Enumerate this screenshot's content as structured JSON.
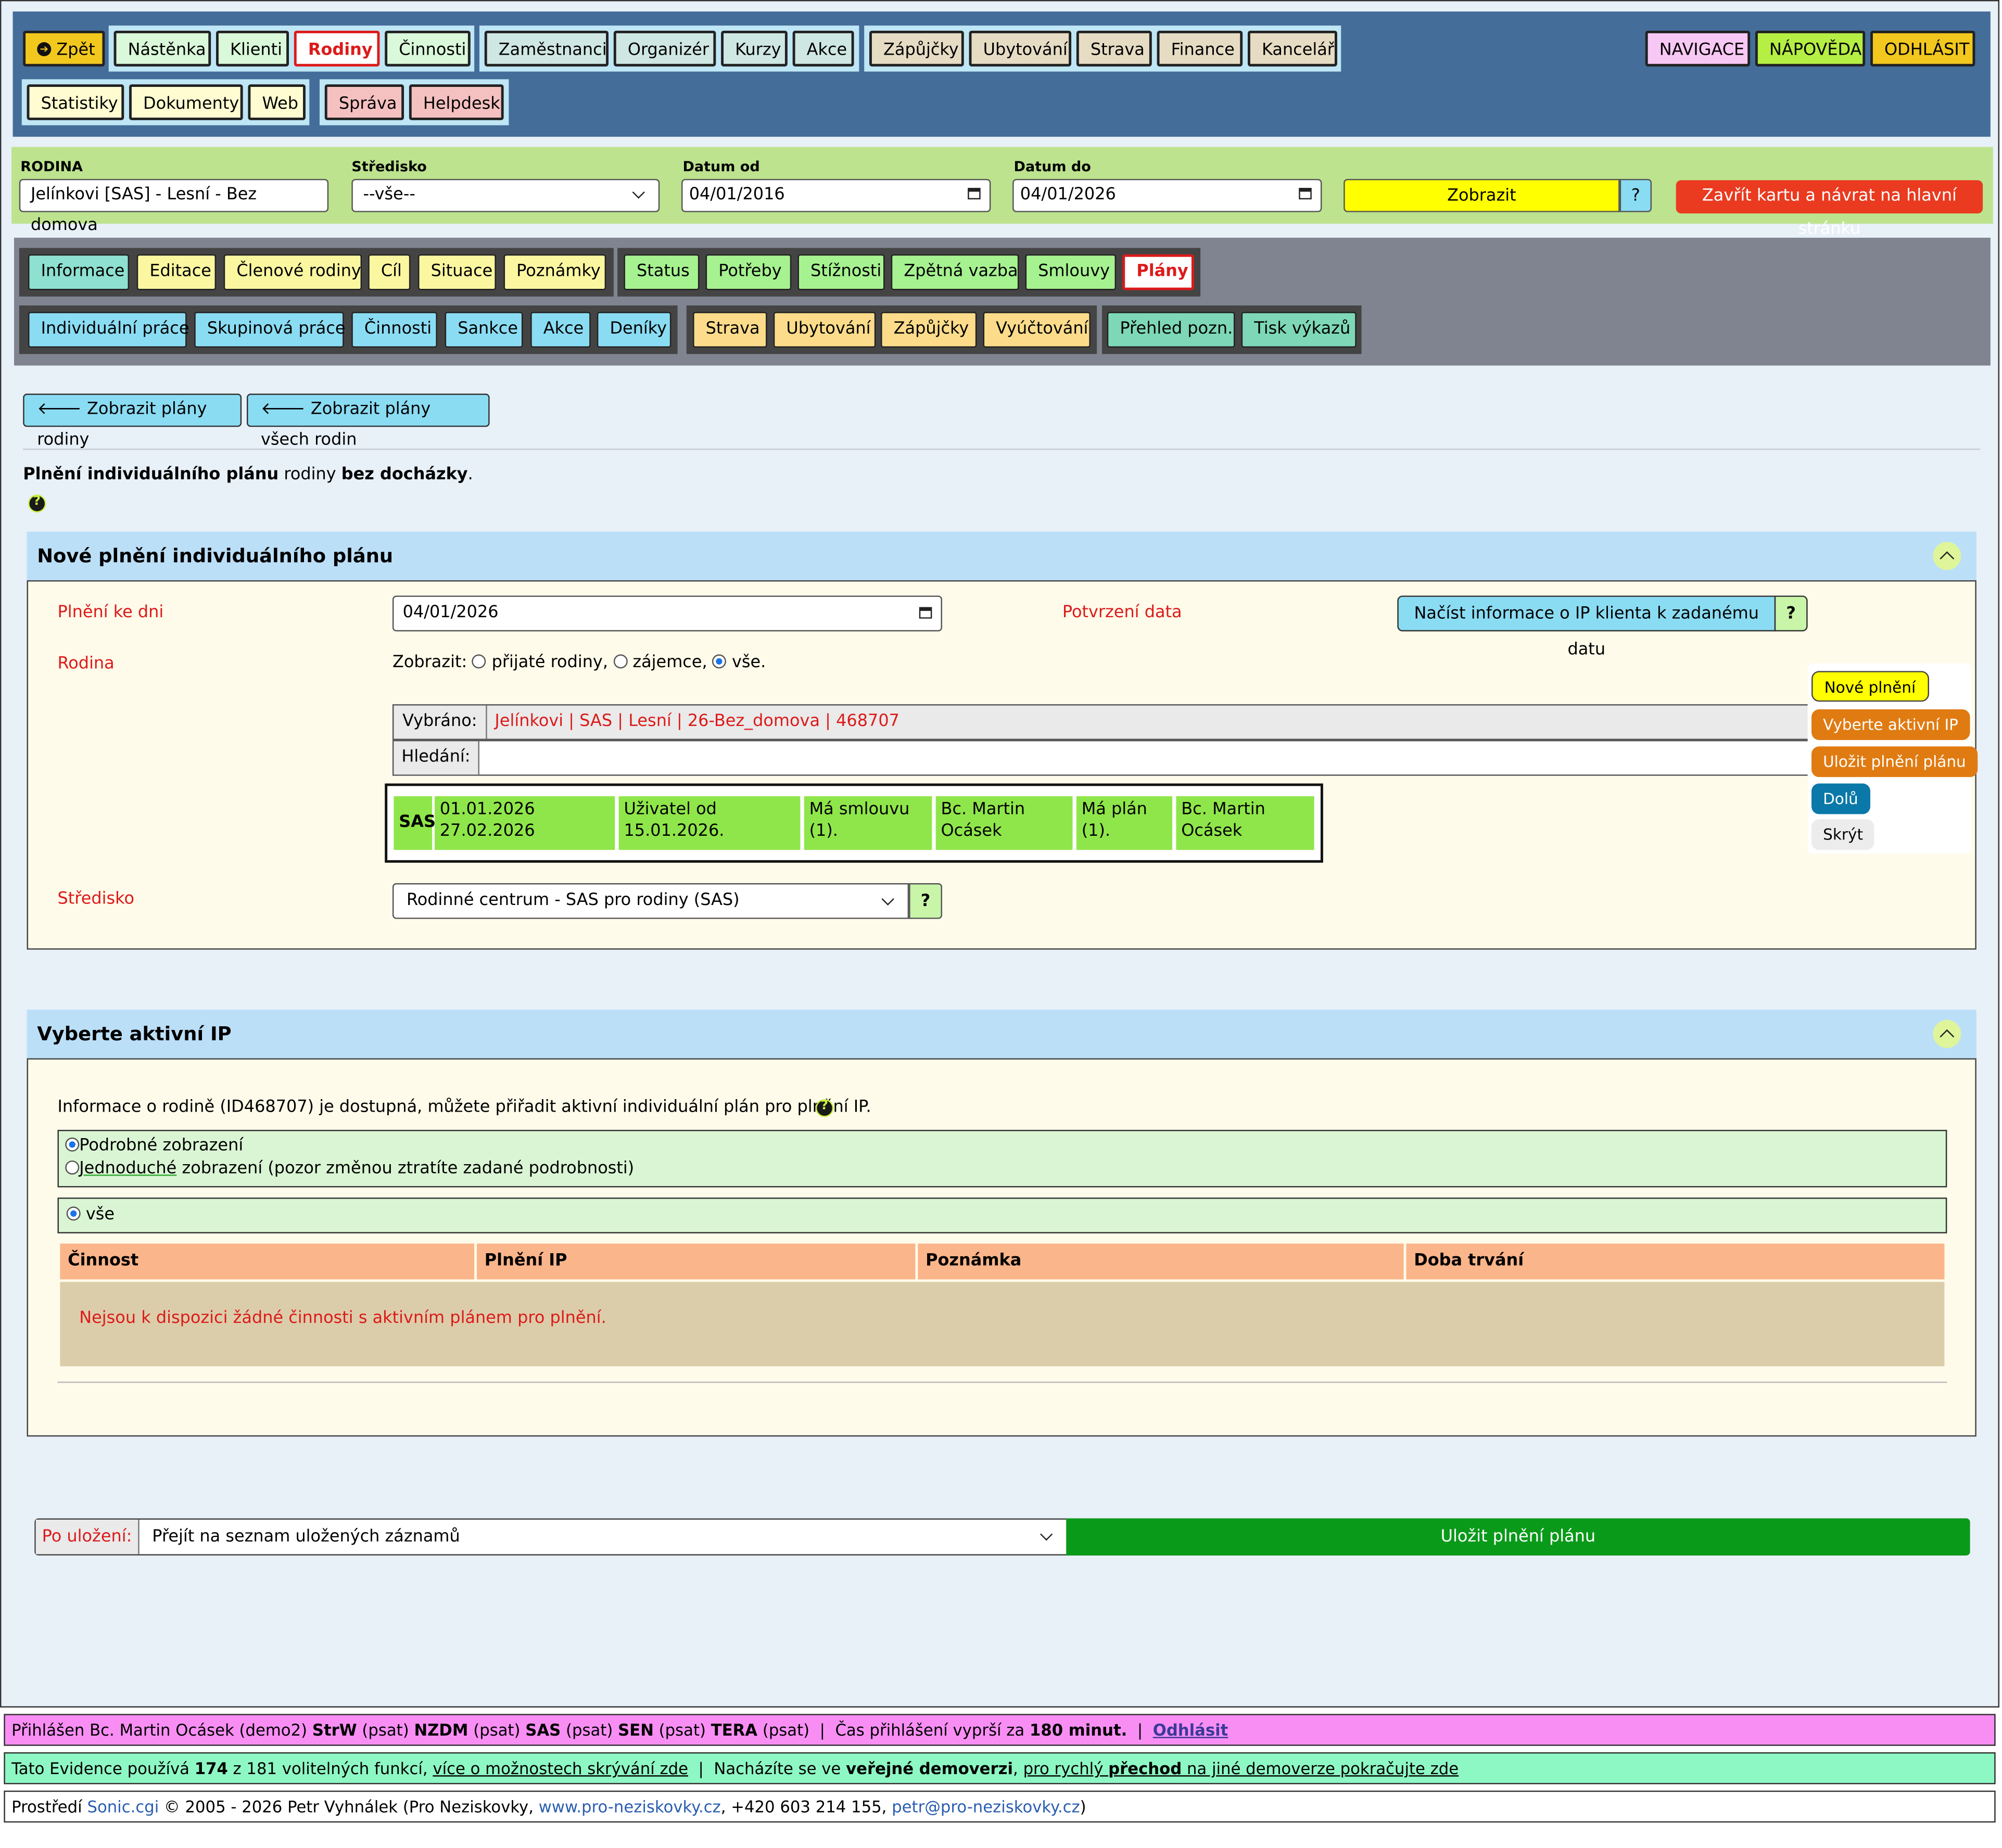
{
  "nav": {
    "back": "Zpět",
    "group1": [
      "Nástěnka",
      "Klienti",
      "Rodiny",
      "Činnosti"
    ],
    "group2": [
      "Zaměstnanci",
      "Organizér",
      "Kurzy",
      "Akce"
    ],
    "group3": [
      "Zápůjčky",
      "Ubytování",
      "Strava",
      "Finance",
      "Kancelář"
    ],
    "group4": [
      "Statistiky",
      "Dokumenty",
      "Web"
    ],
    "group5": [
      "Správa",
      "Helpdesk"
    ],
    "right": [
      "NAVIGACE",
      "NÁPOVĚDA",
      "ODHLÁSIT"
    ]
  },
  "filter": {
    "family_label": "RODINA",
    "family_value": "Jelínkovi [SAS] - Lesní - Bez domova",
    "center_label": "Středisko",
    "center_value": "--vše--",
    "date_from_label": "Datum od",
    "date_from_value": "04/01/2016",
    "date_to_label": "Datum do",
    "date_to_value": "04/01/2026",
    "show_button": "Zobrazit",
    "help": "?",
    "close_button": "Zavřít kartu a návrat na hlavní stránku"
  },
  "subnav": {
    "row1_g1": [
      "Informace",
      "Editace",
      "Členové rodiny",
      "Cíl",
      "Situace",
      "Poznámky"
    ],
    "row1_g2": [
      "Status",
      "Potřeby",
      "Stížnosti",
      "Zpětná vazba",
      "Smlouvy",
      "Plány"
    ],
    "row2_g1": [
      "Individuální práce",
      "Skupinová práce",
      "Činnosti",
      "Sankce",
      "Akce",
      "Deníky"
    ],
    "row2_g2": [
      "Strava",
      "Ubytování",
      "Zápůjčky",
      "Vyúčtování"
    ],
    "row2_g3": [
      "Přehled pozn.",
      "Tisk výkazů"
    ]
  },
  "back_buttons": [
    "Zobrazit plány rodiny",
    "Zobrazit plány všech rodin"
  ],
  "intro": {
    "bold1": "Plnění individuálního plánu",
    "mid": " rodiny ",
    "bold2": "bez docházky",
    "end": "."
  },
  "section1": {
    "title": "Nové plnění individuálního plánu",
    "date_label": "Plnění ke dni",
    "date_value": "04/01/2026",
    "confirm_label": "Potvrzení data",
    "load_button": "Načíst informace o IP klienta k zadanému datu",
    "load_help": "?",
    "family_label": "Rodina",
    "show_label": "Zobrazit:",
    "opt1": "přijaté rodiny,",
    "opt2": "zájemce,",
    "opt3": "vše.",
    "selected_label": "Vybráno:",
    "selected_value": "Jelínkovi | SAS | Lesní | 26-Bez_domova | 468707",
    "search_label": "Hledání:",
    "search_value": "",
    "info": {
      "code": "SAS",
      "c1a": "01.01.2026",
      "c1b": "27.02.2026",
      "c2a": "Uživatel od",
      "c2b": "15.01.2026.",
      "c3a": "Má smlouvu",
      "c3b": "(1).",
      "c4a": "Bc. Martin",
      "c4b": "Ocásek",
      "c5a": "Má plán",
      "c5b": "(1).",
      "c6a": "Bc. Martin",
      "c6b": "Ocásek"
    },
    "center_label": "Středisko",
    "center_value": "Rodinné centrum - SAS pro rodiny (SAS)",
    "center_help": "?"
  },
  "float_panel": [
    "Nové plnění",
    "Vyberte aktivní IP",
    "Uložit plnění plánu",
    "Dolů",
    "Skrýt"
  ],
  "section2": {
    "title": "Vyberte aktivní IP",
    "info": "Informace o rodině (ID468707) je dostupná, můžete přiřadit aktivní individuální plán pro plnění IP.",
    "view1": "Podrobné zobrazení",
    "view2a": "Jednoduché",
    "view2b": " zobrazení (pozor změnou ztratíte zadané podrobnosti)",
    "all": "vše",
    "columns": [
      "Činnost",
      "Plnění IP",
      "Poznámka",
      "Doba trvání"
    ],
    "empty": "Nejsou k dispozici žádné činnosti s aktivním plánem pro plnění."
  },
  "save": {
    "after_label": "Po uložení:",
    "after_value": "Přejít na seznam uložených záznamů",
    "button": "Uložit plnění plánu"
  },
  "footer": {
    "l1a": "Přihlášen Bc. Martin Ocásek (demo2) ",
    "l1b": "StrW",
    "l1c": " (psat) ",
    "l1d": "NZDM",
    "l1e": " (psat) ",
    "l1f": "SAS",
    "l1g": " (psat) ",
    "l1h": "SEN",
    "l1i": " (psat) ",
    "l1j": "TERA",
    "l1k": " (psat)  |  Čas přihlášení vyprší za ",
    "l1l": "180 minut.",
    "l1m": "  |  ",
    "l1n": "Odhlásit",
    "l2a": "Tato Evidence používá ",
    "l2b": "174",
    "l2c": " z 181 volitelných funkcí, ",
    "l2d": "více o možnostech skrývání zde",
    "l2e": "  |  Nacházíte se ve ",
    "l2f": "veřejné demoverzi",
    "l2g": ", ",
    "l2h": "pro rychlý ",
    "l2i": "přechod",
    "l2j": " na jiné demoverze pokračujte zde",
    "l3a": "Prostředí ",
    "l3b": "Sonic.cgi",
    "l3c": " © 2005 - 2026 Petr Vyhnálek (Pro Neziskovky, ",
    "l3d": "www.pro-neziskovky.cz",
    "l3e": ", +420 603 214 155, ",
    "l3f": "petr@pro-neziskovky.cz",
    "l3g": ")"
  },
  "colors": {
    "nav_bg": "#446d99",
    "filter_bg": "#bde38e",
    "active_red": "#dd1a1a",
    "save_green": "#0a9a1a"
  }
}
